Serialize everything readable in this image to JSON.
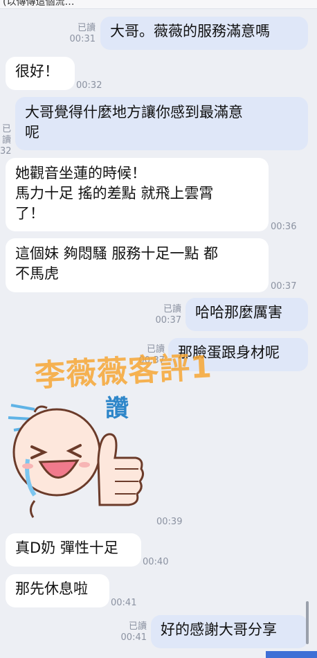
{
  "top_text": "(以傳傳這個流…",
  "read_label": "已讀",
  "watermark": "李薇薇客評1",
  "sticker": {
    "text": "讚",
    "icon": "thumbs-up-crying-sticker"
  },
  "messages": [
    {
      "text": "大哥。薇薇的服務滿意嗎",
      "time": "00:31"
    },
    {
      "text": "很好！",
      "time": "00:32"
    },
    {
      "text": "大哥覺得什麼地方讓你感到最滿意\n呢",
      "time": "32"
    },
    {
      "text": "她觀音坐蓮的時候！\n馬力十足 搖的差點 就飛上雲霄\n了！",
      "time": "00:36"
    },
    {
      "text": "這個妹 夠悶騷 服務十足一點 都\n不馬虎",
      "time": "00:37"
    },
    {
      "text": "哈哈那麼厲害",
      "time": "00:37"
    },
    {
      "text": "那臉蛋跟身材呢",
      "time": "00:37"
    },
    {
      "time": "00:39"
    },
    {
      "text": "真D奶 彈性十足",
      "time": "00:40"
    },
    {
      "text": "那先休息啦",
      "time": "00:41"
    },
    {
      "text": "好的感謝大哥分享",
      "time": "00:41"
    }
  ]
}
